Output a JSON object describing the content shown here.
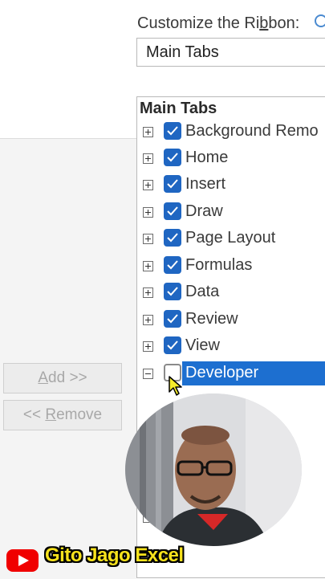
{
  "customize": {
    "label_pre": "Customize the Ri",
    "label_underline": "b",
    "label_post": "bon:"
  },
  "dropdown": {
    "value": "Main Tabs"
  },
  "tree": {
    "header": "Main Tabs",
    "items": [
      {
        "label": "Background Remo",
        "checked": true,
        "expanded": false
      },
      {
        "label": "Home",
        "checked": true,
        "expanded": false
      },
      {
        "label": "Insert",
        "checked": true,
        "expanded": false
      },
      {
        "label": "Draw",
        "checked": true,
        "expanded": false
      },
      {
        "label": "Page Layout",
        "checked": true,
        "expanded": false
      },
      {
        "label": "Formulas",
        "checked": true,
        "expanded": false
      },
      {
        "label": "Data",
        "checked": true,
        "expanded": false
      },
      {
        "label": "Review",
        "checked": true,
        "expanded": false
      },
      {
        "label": "View",
        "checked": true,
        "expanded": false
      },
      {
        "label": "Developer",
        "checked": false,
        "expanded": true,
        "selected": true
      }
    ]
  },
  "buttons": {
    "add": {
      "mnemonic": "A",
      "rest": "dd >>"
    },
    "remove": {
      "prefix": "<< ",
      "mnemonic": "R",
      "rest": "emove"
    }
  },
  "overlay": {
    "channel_name": "Gito Jago Excel",
    "youtube_icon": "youtube-logo-icon"
  },
  "colors": {
    "accent": "#1f66c2",
    "selection": "#1d6fd0",
    "channel_text": "#f7e21c",
    "youtube_red": "#f00000"
  }
}
